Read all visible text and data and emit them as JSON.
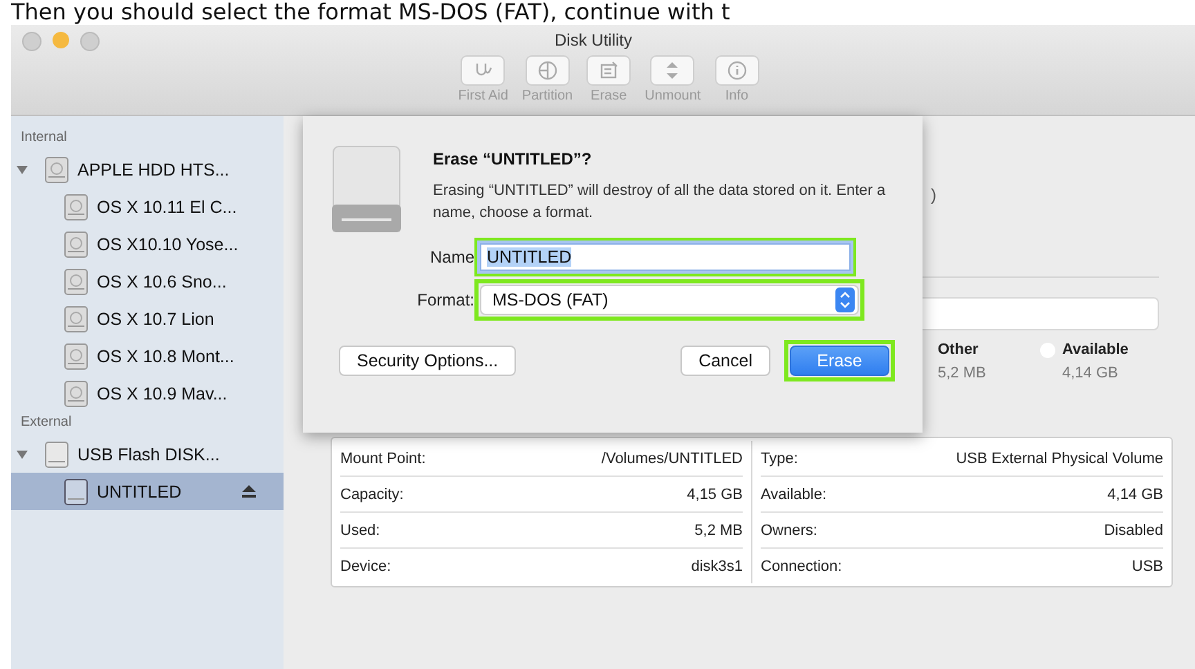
{
  "page_caption": "Then you should select the format MS-DOS (FAT), continue with t",
  "window": {
    "title": "Disk Utility"
  },
  "toolbar": [
    {
      "kind": "first-aid",
      "label": "First Aid"
    },
    {
      "kind": "partition",
      "label": "Partition"
    },
    {
      "kind": "erase",
      "label": "Erase"
    },
    {
      "kind": "unmount",
      "label": "Unmount"
    },
    {
      "kind": "info",
      "label": "Info"
    }
  ],
  "sidebar": {
    "sections": [
      {
        "label": "Internal",
        "items": [
          {
            "label": "APPLE HDD HTS...",
            "kind": "disk",
            "expanded": true,
            "selected": false,
            "ejectable": false,
            "children": [
              {
                "label": "OS X 10.11 El C...",
                "kind": "volume",
                "selected": false,
                "ejectable": false
              },
              {
                "label": "OS X10.10 Yose...",
                "kind": "volume",
                "selected": false,
                "ejectable": false
              },
              {
                "label": "OS X 10.6 Sno...",
                "kind": "volume",
                "selected": false,
                "ejectable": false
              },
              {
                "label": "OS X 10.7 Lion",
                "kind": "volume",
                "selected": false,
                "ejectable": false
              },
              {
                "label": "OS X 10.8 Mont...",
                "kind": "volume",
                "selected": false,
                "ejectable": false
              },
              {
                "label": "OS X 10.9 Mav...",
                "kind": "volume",
                "selected": false,
                "ejectable": false
              }
            ]
          }
        ]
      },
      {
        "label": "External",
        "items": [
          {
            "label": "USB Flash DISK...",
            "kind": "usb",
            "expanded": true,
            "selected": false,
            "ejectable": false,
            "children": [
              {
                "label": "UNTITLED",
                "kind": "usb-volume",
                "selected": true,
                "ejectable": true
              }
            ]
          }
        ]
      }
    ]
  },
  "volume_header": {
    "fragment": ")"
  },
  "usage": {
    "legend": [
      {
        "label": "Other",
        "value": "5,2 MB"
      },
      {
        "label": "Available",
        "value": "4,14 GB",
        "color": "#ffffff"
      }
    ]
  },
  "info_table": {
    "left": [
      {
        "label": "Mount Point:",
        "value": "/Volumes/UNTITLED"
      },
      {
        "label": "Capacity:",
        "value": "4,15 GB"
      },
      {
        "label": "Used:",
        "value": "5,2 MB"
      },
      {
        "label": "Device:",
        "value": "disk3s1"
      }
    ],
    "right": [
      {
        "label": "Type:",
        "value": "USB External Physical Volume"
      },
      {
        "label": "Available:",
        "value": "4,14 GB"
      },
      {
        "label": "Owners:",
        "value": "Disabled"
      },
      {
        "label": "Connection:",
        "value": "USB"
      }
    ]
  },
  "dialog": {
    "title": "Erase “UNTITLED”?",
    "message": "Erasing “UNTITLED” will destroy of all the data stored on it. Enter a name, choose a format.",
    "name_label": "Name",
    "name_value": "UNTITLED",
    "name_highlighted": true,
    "format_label": "Format:",
    "format_value": "MS-DOS (FAT)",
    "format_highlighted": true,
    "buttons": [
      {
        "label": "Security Options...",
        "kind": "plain",
        "highlighted": false
      },
      {
        "label": "Cancel",
        "kind": "plain",
        "highlighted": false
      },
      {
        "label": "Erase",
        "kind": "default",
        "highlighted": true
      }
    ]
  }
}
